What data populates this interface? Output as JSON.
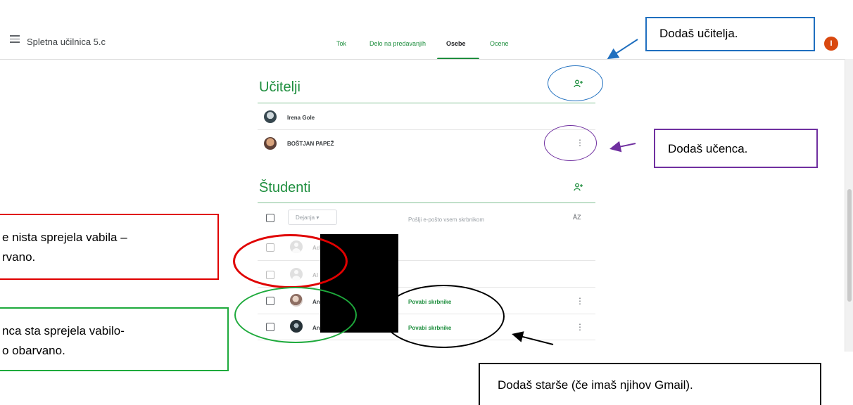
{
  "app": {
    "title": "Spletna učilnica 5.c",
    "user_initial": "I"
  },
  "tabs": [
    {
      "label": "Tok"
    },
    {
      "label": "Delo na predavanjih"
    },
    {
      "label": "Osebe"
    },
    {
      "label": "Ocene"
    }
  ],
  "teachers": {
    "title": "Učitelji",
    "people": [
      {
        "name": "Irena Gole"
      },
      {
        "name": "BOŠTJAN PAPEŽ"
      }
    ]
  },
  "students": {
    "title": "Študenti",
    "actions_label": "Dejanja",
    "email_all": "Pošlji e-pošto vsem skrbnikom",
    "sort_icon": "ÂZ",
    "rows": [
      {
        "name": "Ad"
      },
      {
        "name": "Al"
      },
      {
        "name": "An",
        "action": "Povabi skrbnike"
      },
      {
        "name": "An",
        "action": "Povabi skrbnike"
      }
    ]
  },
  "annotations": {
    "add_teacher": "Dodaš učitelja.",
    "add_student": "Dodaš učenca.",
    "not_accepted_line1": "e nista sprejela vabila –",
    "not_accepted_line2": "rvano.",
    "accepted_line1": "nca sta sprejela vabilo-",
    "accepted_line2": "o obarvano.",
    "add_parents": "Dodaš starše (če imaš njihov Gmail)."
  },
  "colors": {
    "accent_green": "#1e8e3e",
    "annot_blue": "#1f6fbf",
    "annot_purple": "#7030a0",
    "annot_red": "#e00000",
    "annot_green": "#1eaa3c"
  }
}
